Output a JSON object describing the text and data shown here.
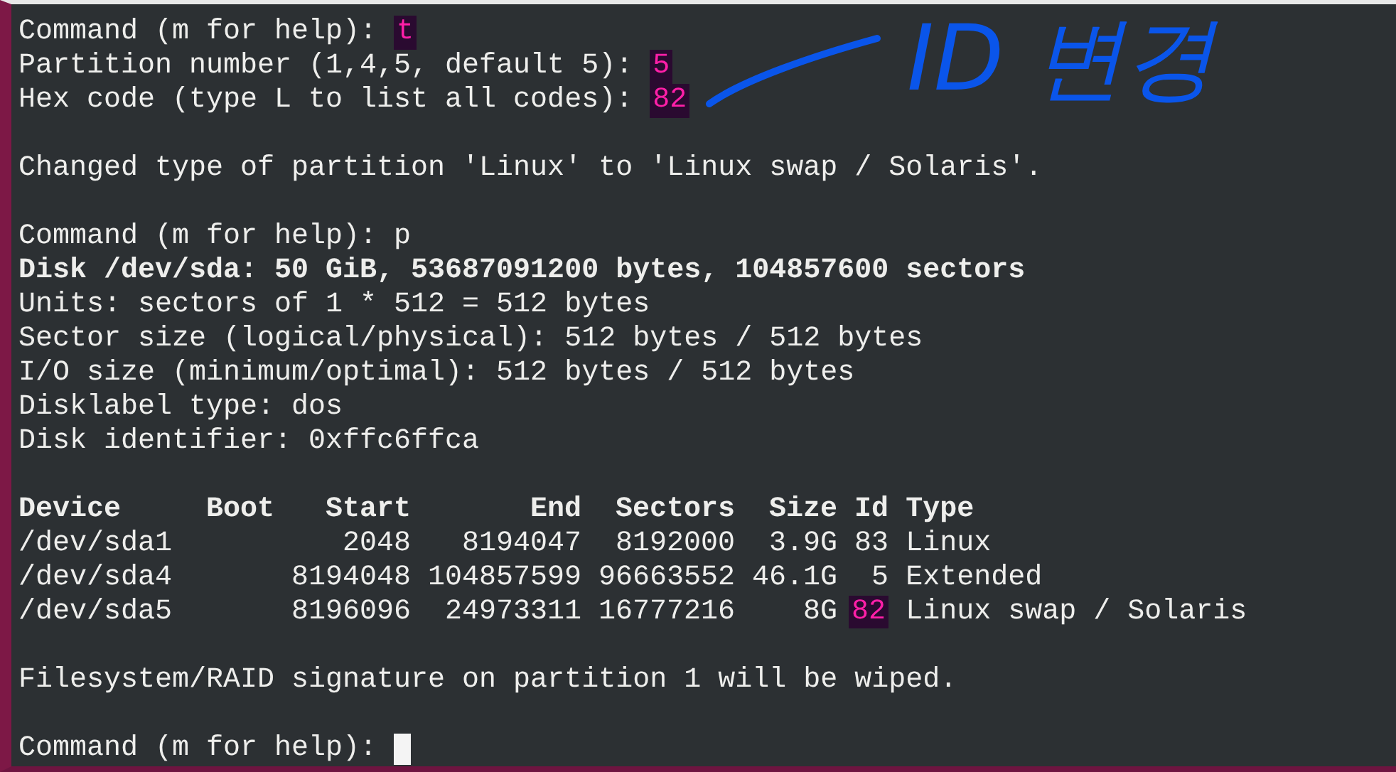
{
  "terminal": {
    "lines": [
      {
        "kind": "input",
        "prompt": "Command (m for help):",
        "input": "t",
        "highlighted": true
      },
      {
        "kind": "input",
        "prompt": "Partition number (1,4,5, default 5):",
        "input": "5",
        "highlighted": true
      },
      {
        "kind": "input",
        "prompt": "Hex code (type L to list all codes):",
        "input": "82",
        "highlighted": true
      },
      {
        "kind": "blank"
      },
      {
        "kind": "text",
        "text": "Changed type of partition 'Linux' to 'Linux swap / Solaris'.",
        "bold": false
      },
      {
        "kind": "blank"
      },
      {
        "kind": "input",
        "prompt": "Command (m for help):",
        "input": "p",
        "highlighted": false
      },
      {
        "kind": "text",
        "text": "Disk /dev/sda: 50 GiB, 53687091200 bytes, 104857600 sectors",
        "bold": true
      },
      {
        "kind": "text",
        "text": "Units: sectors of 1 * 512 = 512 bytes",
        "bold": false
      },
      {
        "kind": "text",
        "text": "Sector size (logical/physical): 512 bytes / 512 bytes",
        "bold": false
      },
      {
        "kind": "text",
        "text": "I/O size (minimum/optimal): 512 bytes / 512 bytes",
        "bold": false
      },
      {
        "kind": "text",
        "text": "Disklabel type: dos",
        "bold": false
      },
      {
        "kind": "text",
        "text": "Disk identifier: 0xffc6ffca",
        "bold": false
      },
      {
        "kind": "blank"
      },
      {
        "kind": "table",
        "columns": [
          "Device",
          "Boot",
          "Start",
          "End",
          "Sectors",
          "Size",
          "Id",
          "Type"
        ],
        "rows": [
          {
            "device": "/dev/sda1",
            "start": "2048",
            "end": "8194047",
            "sectors": "8192000",
            "size": "3.9G",
            "id": "83",
            "type": "Linux",
            "id_highlighted": false
          },
          {
            "device": "/dev/sda4",
            "start": "8194048",
            "end": "104857599",
            "sectors": "96663552",
            "size": "46.1G",
            "id": "5",
            "type": "Extended",
            "id_highlighted": false
          },
          {
            "device": "/dev/sda5",
            "start": "8196096",
            "end": "24973311",
            "sectors": "16777216",
            "size": "8G",
            "id": "82",
            "type": "Linux swap / Solaris",
            "id_highlighted": true
          }
        ]
      },
      {
        "kind": "blank"
      },
      {
        "kind": "text",
        "text": "Filesystem/RAID signature on partition 1 will be wiped.",
        "bold": false
      },
      {
        "kind": "blank"
      },
      {
        "kind": "prompt",
        "prompt": "Command (m for help):"
      }
    ]
  },
  "annotation": {
    "text": "ID 변경"
  }
}
